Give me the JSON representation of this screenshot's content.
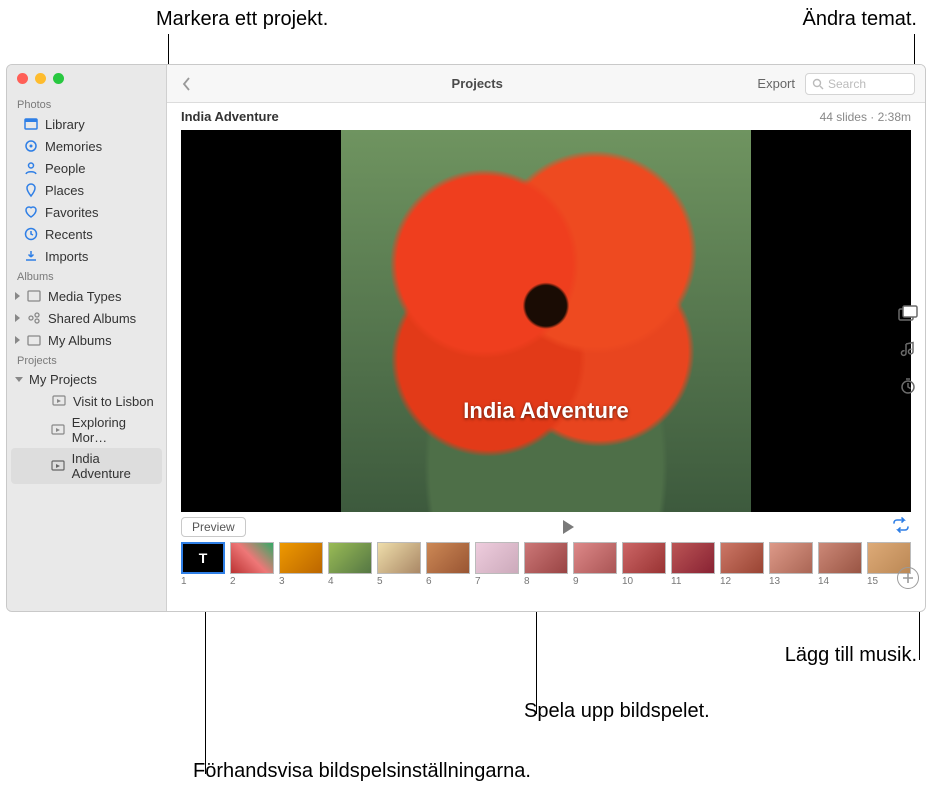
{
  "callouts": {
    "top_left": "Markera ett projekt.",
    "top_right": "Ändra temat.",
    "bottom_1": "Lägg till musik.",
    "bottom_2": "Spela upp bildspelet.",
    "bottom_3": "Förhandsvisa bildspelsinställningarna."
  },
  "toolbar": {
    "title": "Projects",
    "export": "Export",
    "search_placeholder": "Search"
  },
  "project": {
    "name": "India Adventure",
    "meta": "44 slides · 2:38m",
    "preview_title": "India Adventure"
  },
  "controls": {
    "preview": "Preview"
  },
  "sidebar": {
    "sections": {
      "photos": "Photos",
      "albums": "Albums",
      "projects": "Projects"
    },
    "photos_items": [
      "Library",
      "Memories",
      "People",
      "Places",
      "Favorites",
      "Recents",
      "Imports"
    ],
    "albums_items": [
      "Media Types",
      "Shared Albums",
      "My Albums"
    ],
    "projects_root": "My Projects",
    "projects_items": [
      "Visit to Lisbon",
      "Exploring Mor…",
      "India Adventure"
    ]
  },
  "thumbs": {
    "title_glyph": "T",
    "numbers": [
      "1",
      "2",
      "3",
      "4",
      "5",
      "6",
      "7",
      "8",
      "9",
      "10",
      "11",
      "12",
      "13",
      "14",
      "15"
    ]
  }
}
